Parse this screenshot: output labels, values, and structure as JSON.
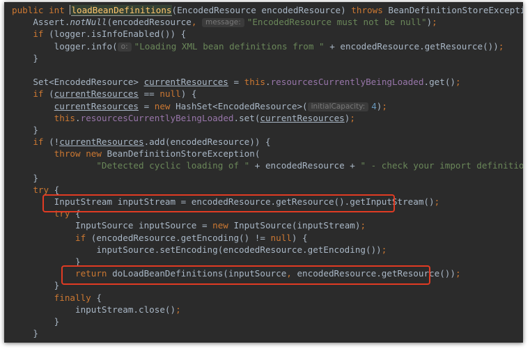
{
  "editor": {
    "lines": [
      {
        "indent": "",
        "tokens": [
          {
            "t": "public",
            "c": "kw"
          },
          {
            "t": " "
          },
          {
            "t": "int",
            "c": "kw"
          },
          {
            "t": " "
          },
          {
            "t": "",
            "c": "caret"
          },
          {
            "t": "loadBeanDefinitions",
            "c": "method mhl"
          },
          {
            "t": "(EncodedResource encodedResource) "
          },
          {
            "t": "throws",
            "c": "kw"
          },
          {
            "t": " BeanDefinitionStoreException {"
          }
        ]
      },
      {
        "indent": "    ",
        "tokens": [
          {
            "t": "Assert."
          },
          {
            "t": "notNull",
            "c": "italic"
          },
          {
            "t": "(encodedResource"
          },
          {
            "t": ",",
            "c": "kw"
          },
          {
            "t": " "
          },
          {
            "t": "message:",
            "c": "hint"
          },
          {
            "t": "\"EncodedResource must not be null\"",
            "c": "str"
          },
          {
            "t": ")"
          },
          {
            "t": ";",
            "c": "kw"
          }
        ]
      },
      {
        "indent": "    ",
        "tokens": [
          {
            "t": "if",
            "c": "kw"
          },
          {
            "t": " (logger.isInfoEnabled()) {"
          }
        ]
      },
      {
        "indent": "        ",
        "tokens": [
          {
            "t": "logger.info("
          },
          {
            "t": "o:",
            "c": "hint"
          },
          {
            "t": "\"Loading XML bean definitions from \"",
            "c": "str"
          },
          {
            "t": " + encodedResource.getResource())"
          },
          {
            "t": ";",
            "c": "kw"
          }
        ]
      },
      {
        "indent": "    ",
        "tokens": [
          {
            "t": "}"
          }
        ]
      },
      {
        "indent": "",
        "tokens": []
      },
      {
        "indent": "    ",
        "tokens": [
          {
            "t": "Set<EncodedResource> "
          },
          {
            "t": "currentResources",
            "c": "ul"
          },
          {
            "t": " = "
          },
          {
            "t": "this",
            "c": "kw"
          },
          {
            "t": "."
          },
          {
            "t": "resourcesCurrentlyBeingLoaded",
            "c": "field"
          },
          {
            "t": ".get()"
          },
          {
            "t": ";",
            "c": "kw"
          }
        ]
      },
      {
        "indent": "    ",
        "tokens": [
          {
            "t": "if",
            "c": "kw"
          },
          {
            "t": " ("
          },
          {
            "t": "currentResources",
            "c": "ul"
          },
          {
            "t": " == "
          },
          {
            "t": "null",
            "c": "kw"
          },
          {
            "t": ") {"
          }
        ]
      },
      {
        "indent": "        ",
        "tokens": [
          {
            "t": "currentResources",
            "c": "ul"
          },
          {
            "t": " = "
          },
          {
            "t": "new",
            "c": "kw"
          },
          {
            "t": " HashSet<EncodedResource>("
          },
          {
            "t": "initialCapacity:",
            "c": "hint"
          },
          {
            "t": "4",
            "c": "num"
          },
          {
            "t": ")"
          },
          {
            "t": ";",
            "c": "kw"
          }
        ]
      },
      {
        "indent": "        ",
        "tokens": [
          {
            "t": "this",
            "c": "kw"
          },
          {
            "t": "."
          },
          {
            "t": "resourcesCurrentlyBeingLoaded",
            "c": "field"
          },
          {
            "t": ".set("
          },
          {
            "t": "currentResources",
            "c": "ul"
          },
          {
            "t": ")"
          },
          {
            "t": ";",
            "c": "kw"
          }
        ]
      },
      {
        "indent": "    ",
        "tokens": [
          {
            "t": "}"
          }
        ]
      },
      {
        "indent": "    ",
        "tokens": [
          {
            "t": "if",
            "c": "kw"
          },
          {
            "t": " (!"
          },
          {
            "t": "currentResources",
            "c": "ul"
          },
          {
            "t": ".add(encodedResource)) {"
          }
        ]
      },
      {
        "indent": "        ",
        "tokens": [
          {
            "t": "throw",
            "c": "kw"
          },
          {
            "t": " "
          },
          {
            "t": "new",
            "c": "kw"
          },
          {
            "t": " BeanDefinitionStoreException("
          }
        ]
      },
      {
        "indent": "                ",
        "tokens": [
          {
            "t": "\"Detected cyclic loading of \"",
            "c": "str"
          },
          {
            "t": " + encodedResource + "
          },
          {
            "t": "\" - check your import definitions!\"",
            "c": "str"
          },
          {
            "t": ")"
          },
          {
            "t": ";",
            "c": "kw"
          }
        ]
      },
      {
        "indent": "    ",
        "tokens": [
          {
            "t": "}"
          }
        ]
      },
      {
        "indent": "    ",
        "tokens": [
          {
            "t": "try",
            "c": "kw"
          },
          {
            "t": " {"
          }
        ]
      },
      {
        "indent": "        ",
        "tokens": [
          {
            "t": "InputStream inputStream = encodedResource.getResource().getInputStream()"
          },
          {
            "t": ";",
            "c": "kw"
          }
        ]
      },
      {
        "indent": "        ",
        "tokens": [
          {
            "t": "try",
            "c": "kw"
          },
          {
            "t": " {"
          }
        ]
      },
      {
        "indent": "            ",
        "tokens": [
          {
            "t": "InputSource inputSource = "
          },
          {
            "t": "new",
            "c": "kw"
          },
          {
            "t": " InputSource(inputStream)"
          },
          {
            "t": ";",
            "c": "kw"
          }
        ]
      },
      {
        "indent": "            ",
        "tokens": [
          {
            "t": "if",
            "c": "kw"
          },
          {
            "t": " (encodedResource.getEncoding() != "
          },
          {
            "t": "null",
            "c": "kw"
          },
          {
            "t": ") {"
          }
        ]
      },
      {
        "indent": "                ",
        "tokens": [
          {
            "t": "inputSource.setEncoding(encodedResource.getEncoding())"
          },
          {
            "t": ";",
            "c": "kw"
          }
        ]
      },
      {
        "indent": "            ",
        "tokens": [
          {
            "t": "}"
          }
        ]
      },
      {
        "indent": "            ",
        "tokens": [
          {
            "t": "return",
            "c": "kw"
          },
          {
            "t": " doLoadBeanDefinitions(inputSource"
          },
          {
            "t": ",",
            "c": "kw"
          },
          {
            "t": " encodedResource.getResource())"
          },
          {
            "t": ";",
            "c": "kw"
          }
        ]
      },
      {
        "indent": "        ",
        "tokens": [
          {
            "t": "}"
          }
        ]
      },
      {
        "indent": "        ",
        "tokens": [
          {
            "t": "finally",
            "c": "kw"
          },
          {
            "t": " {"
          }
        ]
      },
      {
        "indent": "            ",
        "tokens": [
          {
            "t": "inputStream.close()"
          },
          {
            "t": ";",
            "c": "kw"
          }
        ]
      },
      {
        "indent": "        ",
        "tokens": [
          {
            "t": "}"
          }
        ]
      },
      {
        "indent": "    ",
        "tokens": [
          {
            "t": "}"
          }
        ]
      }
    ],
    "highlights": [
      {
        "name": "highlight-inputstream-line",
        "line": 16
      },
      {
        "name": "highlight-return-line",
        "line": 22
      }
    ]
  }
}
